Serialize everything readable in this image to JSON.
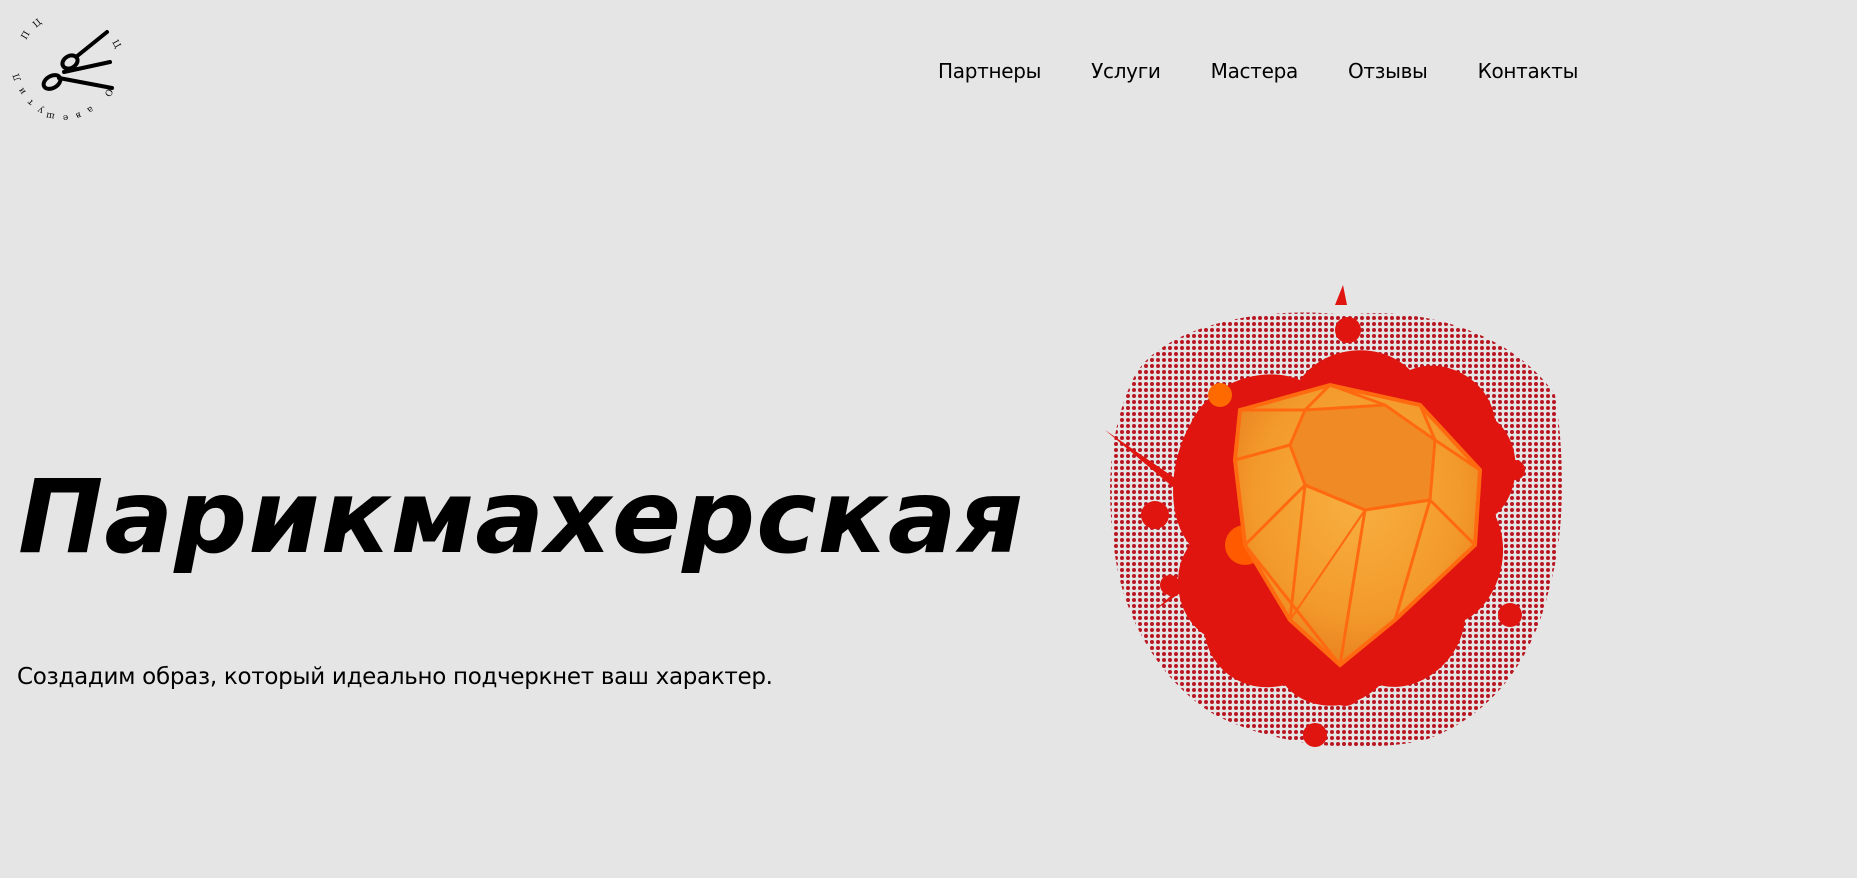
{
  "header": {
    "logo_name": "scissors-logo",
    "nav": [
      {
        "label": "Партнеры"
      },
      {
        "label": "Услуги"
      },
      {
        "label": "Мастера"
      },
      {
        "label": "Отзывы"
      },
      {
        "label": "Контакты"
      }
    ]
  },
  "hero": {
    "title": "Парикмахерская",
    "subtitle": "Создадим образ, который идеально подчеркнет ваш характер.",
    "image_name": "orange-gem-splash-image"
  },
  "colors": {
    "background": "#e5e5e5",
    "text": "#000000",
    "gem_orange": "#f39a2c",
    "splash_red": "#e0150f",
    "halftone_dark_red": "#b3000c"
  }
}
